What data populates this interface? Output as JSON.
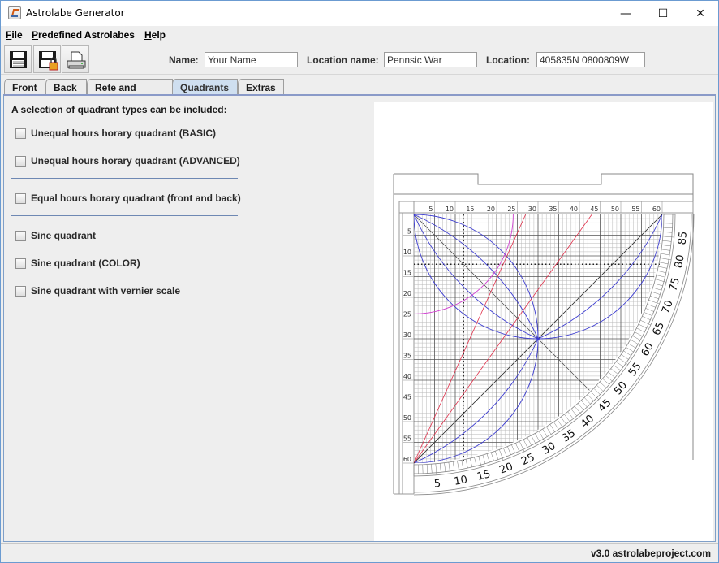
{
  "window": {
    "title": "Astrolabe Generator",
    "controls": {
      "minimize": "—",
      "maximize": "☐",
      "close": "✕"
    }
  },
  "menu": [
    {
      "label": "File",
      "mnemonic": "F",
      "rest": "ile"
    },
    {
      "label": "Predefined Astrolabes",
      "mnemonic": "P",
      "rest": "redefined Astrolabes"
    },
    {
      "label": "Help",
      "mnemonic": "H",
      "rest": "elp"
    }
  ],
  "toolbar": {
    "buttons": [
      {
        "name": "save",
        "icon": "floppy-disk-icon"
      },
      {
        "name": "save-as",
        "icon": "floppy-disk-lock-icon"
      },
      {
        "name": "print",
        "icon": "printer-icon"
      }
    ],
    "name_label": "Name:",
    "name_value": "Your Name",
    "location_name_label": "Location name:",
    "location_name_value": "Pennsic War",
    "location_label": "Location:",
    "location_value": "405835N 0800809W"
  },
  "tabs": [
    {
      "label": "Front",
      "active": false
    },
    {
      "label": "Back",
      "active": false
    },
    {
      "label": "Rete and Rules",
      "active": false
    },
    {
      "label": "Quadrants",
      "active": true
    },
    {
      "label": "Extras",
      "active": false
    }
  ],
  "quadrants": {
    "heading": "A selection of quadrant types can be included:",
    "options": [
      {
        "label": "Unequal hours horary quadrant (BASIC)",
        "checked": false
      },
      {
        "label": "Unequal hours horary quadrant (ADVANCED)",
        "checked": false
      },
      {
        "label": "Equal hours horary quadrant (front and back)",
        "checked": false
      },
      {
        "label": "Sine quadrant",
        "checked": false
      },
      {
        "label": "Sine quadrant (COLOR)",
        "checked": false
      },
      {
        "label": "Sine quadrant with vernier scale",
        "checked": false
      }
    ]
  },
  "preview": {
    "top_scale_labels": [
      "5",
      "10",
      "15",
      "20",
      "25",
      "30",
      "35",
      "40",
      "45",
      "50",
      "55",
      "60"
    ],
    "left_scale_labels": [
      "5",
      "10",
      "15",
      "20",
      "25",
      "30",
      "35",
      "40",
      "45",
      "50",
      "55",
      "60"
    ],
    "arc_scale_labels": [
      "5",
      "10",
      "15",
      "20",
      "25",
      "30",
      "35",
      "40",
      "45",
      "50",
      "55",
      "60",
      "65",
      "70",
      "75",
      "80",
      "85"
    ],
    "colors": {
      "grid": "#555555",
      "fine_grid": "#b8b8b8",
      "blue": "#3b3bd0",
      "red": "#e0304a",
      "magenta": "#d040d0"
    }
  },
  "status": {
    "text": "v3.0 astrolabeproject.com"
  }
}
